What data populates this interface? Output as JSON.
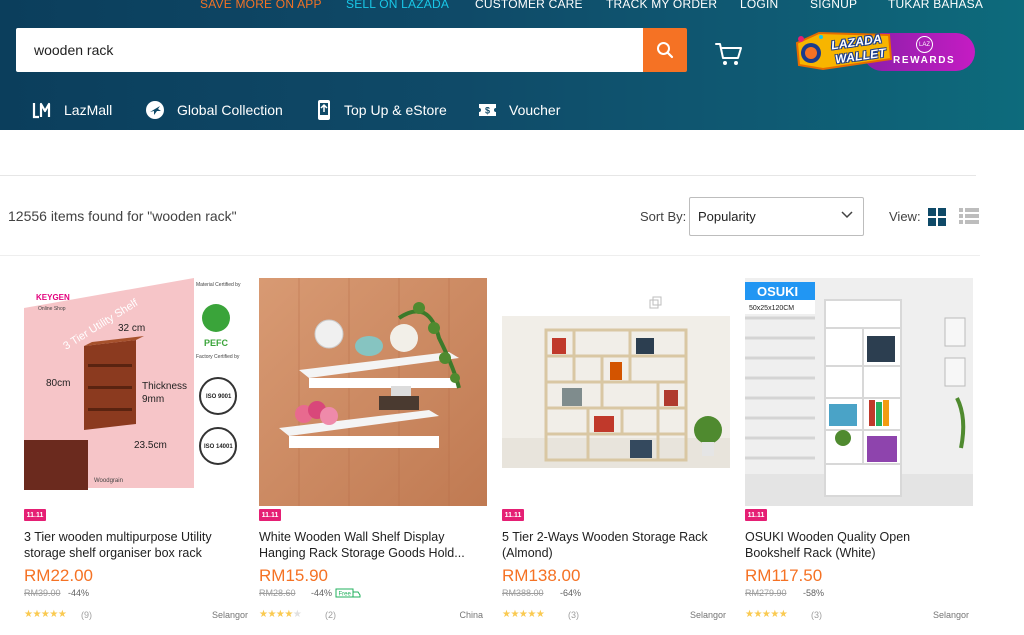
{
  "topnav": {
    "save_app": "SAVE MORE ON APP",
    "sell": "SELL ON LAZADA",
    "care": "CUSTOMER CARE",
    "track": "TRACK MY ORDER",
    "login": "LOGIN",
    "signup": "SIGNUP",
    "language": "TUKAR BAHASA"
  },
  "search": {
    "value": "wooden rack"
  },
  "wallet": {
    "line1": "LAZADA",
    "line2": "WALLET",
    "rewards": "REWARDS",
    "laz": "LAZ"
  },
  "categories": [
    {
      "label": "LazMall",
      "icon": "lazmall-icon"
    },
    {
      "label": "Global Collection",
      "icon": "globe-plane-icon"
    },
    {
      "label": "Top Up & eStore",
      "icon": "phone-topup-icon"
    },
    {
      "label": "Voucher",
      "icon": "voucher-icon"
    }
  ],
  "results": {
    "count_text": "12556 items found for \"wooden rack\"",
    "sort_label": "Sort By:",
    "sort_value": "Popularity",
    "view_label": "View:"
  },
  "products": [
    {
      "badge": "11.11",
      "title_l1": "3 Tier wooden multipurpose Utility",
      "title_l2": "storage shelf organiser box rack",
      "price": "RM22.00",
      "old_price": "RM39.00",
      "discount": "-44%",
      "rating": 5,
      "reviews": "(9)",
      "location": "Selangor",
      "image_text": {
        "brand": "KEYGEN",
        "brand_sub": "Online Shop",
        "diag": "3 Tier Utility Shelf",
        "w": "32 cm",
        "h": "80cm",
        "d": "23.5cm",
        "thick1": "Thickness",
        "thick2": "9mm",
        "material": "Material Certified by",
        "pefc": "PEFC",
        "factory": "Factory Certified by",
        "iso1": "ISO 9001",
        "iso2": "ISO 14001",
        "wood": "Woodgrain"
      }
    },
    {
      "badge": "11.11",
      "title_l1": "White Wooden Wall Shelf Display",
      "title_l2": "Hanging Rack Storage Goods Hold...",
      "price": "RM15.90",
      "old_price": "RM28.60",
      "discount": "-44%",
      "free": "Free",
      "rating": 4,
      "reviews": "(2)",
      "location": "China"
    },
    {
      "badge": "11.11",
      "title_l1": "5 Tier 2-Ways Wooden Storage Rack",
      "title_l2": "(Almond)",
      "price": "RM138.00",
      "old_price": "RM388.00",
      "discount": "-64%",
      "rating": 5,
      "reviews": "(3)",
      "location": "Selangor"
    },
    {
      "badge": "11.11",
      "title_l1": "OSUKI Wooden Quality Open",
      "title_l2": "Bookshelf Rack (White)",
      "price": "RM117.50",
      "old_price": "RM279.90",
      "discount": "-58%",
      "rating": 5,
      "reviews": "(3)",
      "location": "Selangor",
      "image_text": {
        "brand": "OSUKI",
        "size": "50x25x120CM"
      }
    }
  ],
  "colors": {
    "accent_orange": "#f57224",
    "header_dark": "#0b3e5c",
    "badge_pink": "#e51f74",
    "star": "#faca51"
  }
}
